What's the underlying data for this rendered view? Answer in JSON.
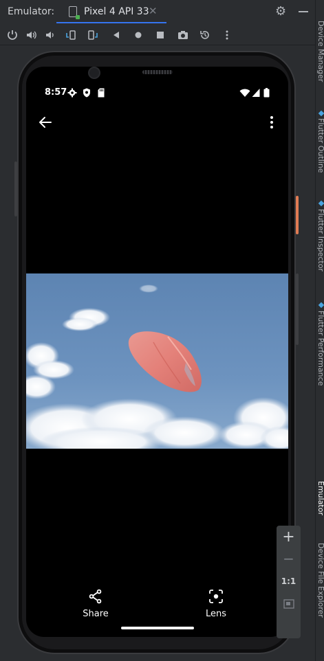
{
  "window": {
    "label": "Emulator:",
    "tab_title": "Pixel 4 API 33",
    "tab_close": "✕"
  },
  "right_panels": [
    {
      "label": "Device Manager"
    },
    {
      "label": "Flutter Outline"
    },
    {
      "label": "Flutter Inspector"
    },
    {
      "label": "Flutter Performance"
    },
    {
      "label": "Emulator"
    },
    {
      "label": "Device File Explorer"
    }
  ],
  "status_bar": {
    "time": "8:57"
  },
  "actions": {
    "share_label": "Share",
    "lens_label": "Lens"
  },
  "zoom": {
    "plus": "+",
    "minus": "−",
    "one_to_one": "1:1"
  },
  "colors": {
    "accent": "#3574f0",
    "sky": "#6a91bd",
    "bag": "#f0867a"
  }
}
